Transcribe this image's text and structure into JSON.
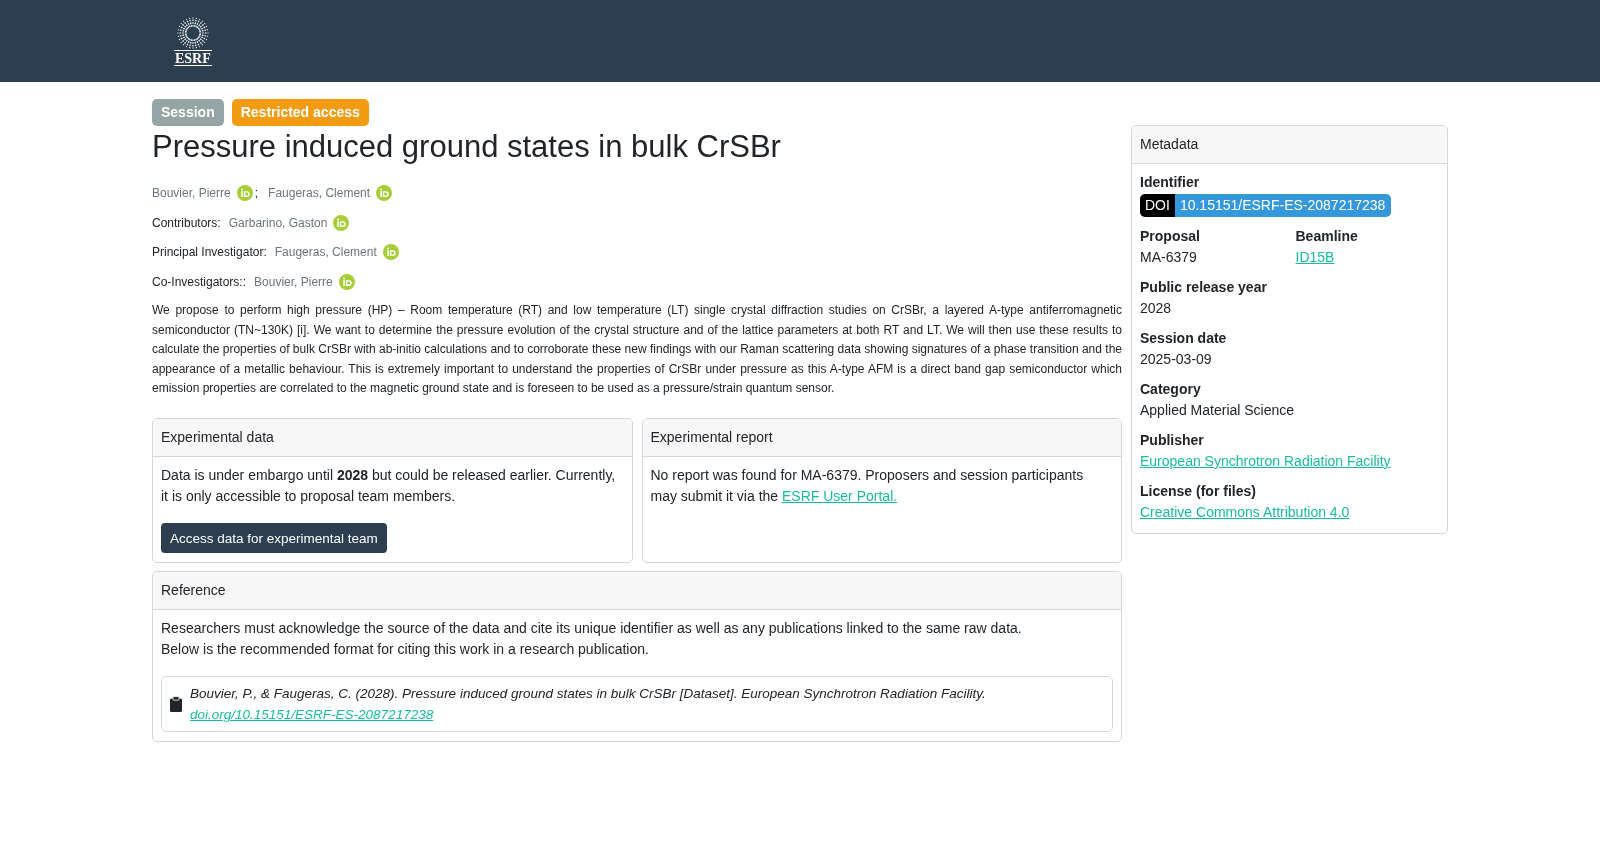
{
  "header": {
    "logo_text": "ESRF"
  },
  "badges": [
    {
      "label": "Session",
      "color": "#95a5a6"
    },
    {
      "label": "Restricted access",
      "color": "#f39c12"
    }
  ],
  "title": "Pressure induced ground states in bulk CrSBr",
  "authors": {
    "names": [
      "Bouvier, Pierre",
      "Faugeras, Clement"
    ],
    "separator": ";"
  },
  "roles": [
    {
      "label": "Contributors:",
      "names": [
        "Garbarino, Gaston"
      ]
    },
    {
      "label": "Principal Investigator:",
      "names": [
        "Faugeras, Clement"
      ]
    },
    {
      "label": "Co-Investigators::",
      "names": [
        "Bouvier, Pierre"
      ]
    }
  ],
  "abstract": "We propose to perform high pressure (HP) – Room temperature (RT) and low temperature (LT) single crystal diffraction studies on CrSBr, a layered A-type antiferromagnetic semiconductor (TN~130K) [i]. We want to determine the pressure evolution of the crystal structure and of the lattice parameters at both RT and LT. We will then use these results to calculate the properties of bulk CrSBr with ab-initio calculations and to corroborate these new findings with our Raman scattering data showing signatures of a phase transition and the appearance of a metallic behaviour. This is extremely important to understand the properties of CrSBr under pressure as this A-type AFM is a direct band gap semiconductor which emission properties are correlated to the magnetic ground state and is foreseen to be used as a pressure/strain quantum sensor.",
  "experimental_data": {
    "title": "Experimental data",
    "text": "Data is under embargo until **2028** but could be released earlier. Currently, it is only accessible to proposal team members.",
    "button": "Access data for experimental team"
  },
  "experimental_report": {
    "title": "Experimental report",
    "text": "No report was found for MA-6379. Proposers and session participants may submit it via the",
    "link": "ESRF User Portal."
  },
  "reference": {
    "title": "Reference",
    "lines": [
      "Researchers must acknowledge the source of the data and cite its unique identifier as well as any publications linked to the same raw data.",
      "Below is the recommended format for citing this work in a research publication."
    ],
    "citation": "Bouvier, P., & Faugeras, C. (2028). Pressure induced ground states in bulk CrSBr [Dataset]. European Synchrotron Radiation Facility.",
    "citation_link": "doi.org/10.15151/ESRF-ES-2087217238"
  },
  "metadata": {
    "title": "Metadata",
    "rows": [
      [
        {
          "label": "Identifier",
          "kind": "doi",
          "prefix": "DOI",
          "value": "10.15151/ESRF-ES-2087217238"
        }
      ],
      [
        {
          "label": "Proposal",
          "kind": "text",
          "value": "MA-6379"
        },
        {
          "label": "Beamline",
          "kind": "link",
          "value": "ID15B"
        }
      ],
      [
        {
          "label": "Public release year",
          "kind": "text",
          "value": "2028"
        }
      ],
      [
        {
          "label": "Session date",
          "kind": "text",
          "value": "2025-03-09"
        }
      ],
      [
        {
          "label": "Category",
          "kind": "text",
          "value": "Applied Material Science"
        }
      ],
      [
        {
          "label": "Publisher",
          "kind": "link",
          "value": "European Synchrotron Radiation Facility"
        }
      ],
      [
        {
          "label": "License (for files)",
          "kind": "link",
          "value": "Creative Commons Attribution 4.0"
        }
      ]
    ]
  }
}
